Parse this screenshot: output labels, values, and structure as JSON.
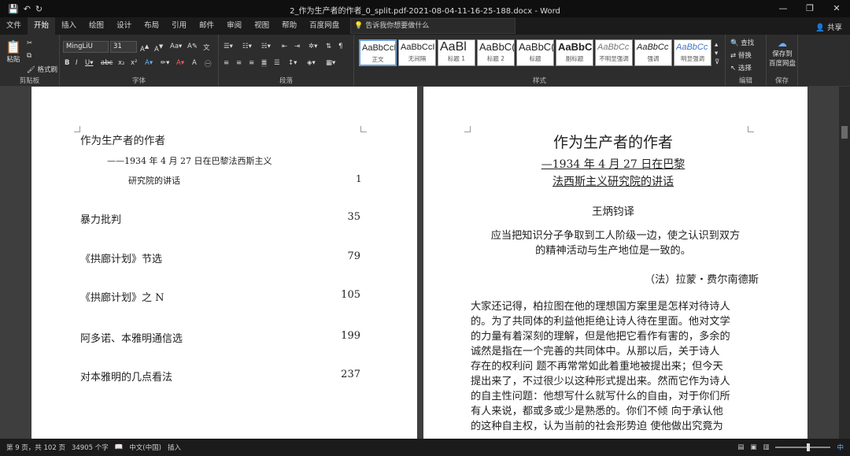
{
  "window": {
    "title": "2_作为生产者的作者_0_split.pdf-2021-08-04-11-16-25-188.docx - Word",
    "controls": [
      "—",
      "❐",
      "✕"
    ]
  },
  "qat": {
    "save": "💾",
    "undo": "↶",
    "redo": "↻"
  },
  "menu": {
    "tabs": [
      "文件",
      "开始",
      "插入",
      "绘图",
      "设计",
      "布局",
      "引用",
      "邮件",
      "审阅",
      "视图",
      "帮助",
      "百度网盘"
    ],
    "tellme": "告诉我你想要做什么",
    "share": "共享"
  },
  "ribbon": {
    "clipboard": {
      "paste": "粘贴",
      "format_painter": "格式刷",
      "label": "剪贴板"
    },
    "font": {
      "name": "MingLiU",
      "size": "31",
      "label": "字体"
    },
    "paragraph": {
      "label": "段落"
    },
    "styles": {
      "label": "样式",
      "items": [
        {
          "sample": "AaBbCcI",
          "name": "正文"
        },
        {
          "sample": "AaBbCcI",
          "name": "无间隔"
        },
        {
          "sample": "AaBl",
          "name": "标题 1"
        },
        {
          "sample": "AaBbC(",
          "name": "标题 2"
        },
        {
          "sample": "AaBbC(",
          "name": "标题"
        },
        {
          "sample": "AaBbC(",
          "name": "副标题"
        },
        {
          "sample": "AaBbCc",
          "name": "不明显强调"
        },
        {
          "sample": "AaBbCc",
          "name": "强调"
        },
        {
          "sample": "AaBbCc",
          "name": "明显强调"
        }
      ]
    },
    "editing": {
      "find": "查找",
      "replace": "替换",
      "select": "选择",
      "label": "编辑"
    },
    "save": {
      "line1": "保存到",
      "line2": "百度网盘",
      "label": "保存"
    }
  },
  "left_page": {
    "title": "作为生产者的作者",
    "subtitle": "——1934 年 4 月 27 日在巴黎法西斯主义",
    "subtitle2": "研究院的讲话",
    "page1": "1",
    "toc": [
      {
        "title": "暴力批判",
        "page": "35"
      },
      {
        "title": "《拱廊计划》节选",
        "page": "79"
      },
      {
        "title": "《拱廊计划》之 N",
        "page": "105"
      },
      {
        "title": "阿多诺、本雅明通信选",
        "page": "199"
      },
      {
        "title": "对本雅明的几点看法",
        "page": "237"
      }
    ]
  },
  "right_page": {
    "title": "作为生产者的作者",
    "sub1": "—1934 年 4 月 27 日在巴黎",
    "sub2": "法西斯主义研究院的讲话",
    "translator": "王炳钧译",
    "epigraph1": "应当把知识分子争取到工人阶级一边，使之认识到双方",
    "epigraph2": "的精神活动与生产地位是一致的。",
    "attribution": "（法）拉蒙・费尔南德斯",
    "body": [
      "大家还记得，柏拉图在他的理想国方案里是怎样对待诗人",
      "的。为了共同体的利益他拒绝让诗人待在里面。他对文学",
      "的力量有着深刻的理解，但是他把它看作有害的，多余的",
      "诚然是指在一个完善的共同体中。从那以后，关于诗人",
      "存在的权利问 题不再常常如此着重地被提出来；但今天",
      "提出来了，不过很少以这种形式提出来。然而它作为诗人",
      "的自主性问题：他想写什么就写什么的自由，对于你们所",
      "有人来说，都或多或少是熟悉的。你们不倾 向于承认他",
      "的这种自主权，认为当前的社会形势迫 使他做出究竟为"
    ]
  },
  "status": {
    "page": "第 9 页，共 102 页",
    "words": "34905 个字",
    "lang": "中文(中国)",
    "mode": "插入"
  }
}
